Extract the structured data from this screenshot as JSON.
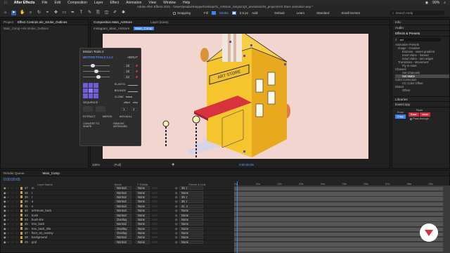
{
  "menubar": {
    "brand": "After Effects",
    "items": [
      "File",
      "Edit",
      "Composition",
      "Layer",
      "Effect",
      "Animation",
      "View",
      "Window",
      "Help"
    ],
    "right_status": "99%"
  },
  "titlebar": "Adobe After Effects 2021 - /Users/peadarsheppe/Desktop/01_ArtStore_isingtonQ3_animation/04_projects/Art Store animation.aep *",
  "toolbar": {
    "snapping": "Snapping",
    "fill": "Fill",
    "stroke": "Stroke",
    "stroke_width": "2.5 px",
    "add": "Add:",
    "workspaces": [
      "Default",
      "Learn",
      "Standard",
      "Small Screen"
    ],
    "search_placeholder": "Search Help"
  },
  "left_panel": {
    "tabs": [
      "Project",
      "Effect Controls ele_stroke_Outlines"
    ],
    "subtitle": "Main_Comp • ele stroke_Outlines"
  },
  "comp_panel": {
    "tabs": [
      "Composition Main_ArtStore"
    ],
    "layer_tab": "Layer (none)",
    "breadcrumbs": [
      "Instagram_Main_ArtStore",
      "Main_Comp"
    ],
    "zoom": "100%",
    "resolution": "(Full)",
    "timecode": "0:00:00:05"
  },
  "motion_tools": {
    "title": "Motion Tools 2",
    "logo": "MOTION TOOLS 2.1.2",
    "about": "ABOUT",
    "sliders": [
      {
        "value": "18"
      },
      {
        "value": "18"
      },
      {
        "value": "34"
      }
    ],
    "labels": {
      "elastic": "ELASTIC",
      "bounce": "BOUNCE",
      "clone": "CLONE",
      "sequence": "SEQUENCE",
      "offset": "offset",
      "step": "step",
      "offset_val": "1",
      "step_val": "2",
      "extract": "EXTRACT",
      "merge": "MERGE",
      "anchor": "ANY-NULL",
      "convert": "CONVERT TO SHAPE",
      "remove": "REMOVE ARTBOARD"
    }
  },
  "right_panel": {
    "info": "Info",
    "audio": "Audio",
    "effects_presets": "Effects & Presets",
    "search_value": "set",
    "tree": [
      "Animation Presets",
      "Image - Creative",
      "Emboss - sweet gradient",
      "Inset Video - framed",
      "Inset Video - torn edges",
      "Transitions - Movement",
      "Fly In Inset",
      "Channel",
      "Set Channels",
      "Set Matte",
      "Color Correction",
      "CC Color Offset",
      "Distort",
      "Offset"
    ],
    "libraries": "Libraries",
    "easecopy_title": "EaseCopy",
    "easecopy": {
      "from": "From",
      "copy": "Copy",
      "paste": "Paste",
      "ease": "Ease",
      "value": "Value",
      "pass": "Pass-through"
    }
  },
  "timeline": {
    "tabs": [
      "Render Queue",
      "Main_Comp"
    ],
    "timecode": "0:00:00:05",
    "columns": {
      "source": "Layer Name",
      "mode": "Mode",
      "trkmat": "T TrkMat",
      "parent": "Parent & Link"
    },
    "ruler": [
      "0s",
      "01s",
      "02s",
      "03s",
      "04s",
      "05s",
      "06s",
      "07s",
      "08s",
      "09s"
    ],
    "layers": [
      {
        "num": "37",
        "name": "m",
        "mode": "Normal",
        "trk": "None",
        "parent": "38. t"
      },
      {
        "num": "38",
        "name": "t",
        "mode": "Normal",
        "trk": "None",
        "parent": "None"
      },
      {
        "num": "39",
        "name": "r",
        "mode": "Normal",
        "trk": "None",
        "parent": "38. t"
      },
      {
        "num": "40",
        "name": "a",
        "mode": "Normal",
        "trk": "None",
        "parent": "38. t"
      },
      {
        "num": "41",
        "name": "e",
        "mode": "Normal",
        "trk": "None",
        "parent": "41. e"
      },
      {
        "num": "42",
        "name": "artHouse_back",
        "mode": "Normal",
        "trk": "None",
        "parent": "None"
      },
      {
        "num": "43",
        "name": "bush",
        "mode": "Normal",
        "trk": "None",
        "parent": "None"
      },
      {
        "num": "44",
        "name": "bush shs",
        "mode": "Overlay",
        "trk": "None",
        "parent": "None"
      },
      {
        "num": "45",
        "name": "tree_back",
        "mode": "Normal",
        "trk": "None",
        "parent": "None"
      },
      {
        "num": "46",
        "name": "tree_back_shs",
        "mode": "Overlay",
        "trk": "None",
        "parent": "None"
      },
      {
        "num": "47",
        "name": "floor_txt_overlay",
        "mode": "Overlay",
        "trk": "None",
        "parent": "None"
      },
      {
        "num": "48",
        "name": "background",
        "mode": "Normal",
        "trk": "None",
        "parent": "None"
      },
      {
        "num": "49",
        "name": "grid",
        "mode": "Normal",
        "trk": "None",
        "parent": "None"
      }
    ]
  },
  "canvas": {
    "sign_text": "ART STORE"
  },
  "colors": {
    "accent": "#3d83f2",
    "canvas_bg": "#f3d5cf",
    "building": "#f0bd2c",
    "awning": "#d8323f",
    "label_red": "#c8323f"
  }
}
